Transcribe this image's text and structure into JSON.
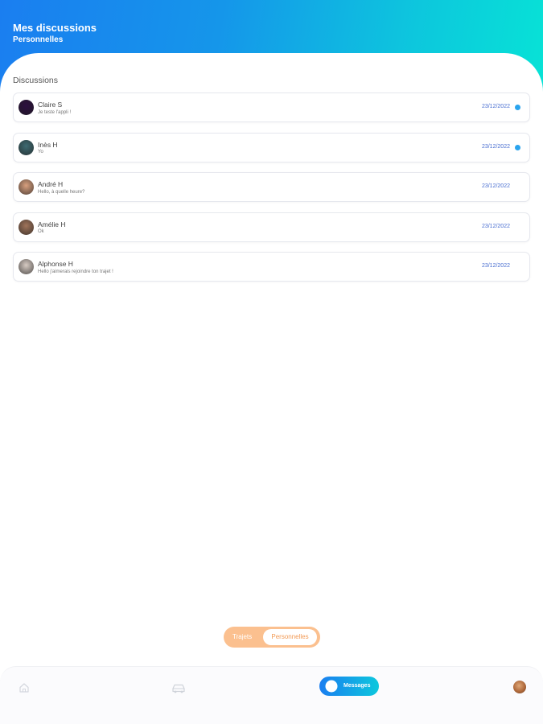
{
  "header": {
    "title": "Mes discussions",
    "subtitle": "Personnelles"
  },
  "section_label": "Discussions",
  "conversations": [
    {
      "name": "Claire S",
      "preview": "Je teste l'appli !",
      "date": "23/12/2022",
      "unread": true,
      "avatar_color": "#2c0f3f"
    },
    {
      "name": "Inès H",
      "preview": "Yo",
      "date": "23/12/2022",
      "unread": true,
      "avatar_color": "#3f6b72"
    },
    {
      "name": "André  H",
      "preview": "Hello, à quelle heure?",
      "date": "23/12/2022",
      "unread": false,
      "avatar_color": "#d9a07e"
    },
    {
      "name": "Amélie H",
      "preview": "Ok",
      "date": "23/12/2022",
      "unread": false,
      "avatar_color": "#a0745a"
    },
    {
      "name": "Alphonse  H",
      "preview": "Hello j'aimerais rejoindre ton trajet !",
      "date": "23/12/2022",
      "unread": false,
      "avatar_color": "#d7cbc3"
    }
  ],
  "toggle": {
    "left_label": "Trajets",
    "right_label": "Personnelles",
    "selected": "Personnelles"
  },
  "nav": {
    "home_icon": "home-icon",
    "car_icon": "car-icon",
    "messages_label": "Messages",
    "messages_icon": "chat-bubble-icon",
    "profile_icon": "profile-avatar"
  },
  "colors": {
    "header_start": "#1a7ef0",
    "header_end": "#07e3d6",
    "date": "#4a6fd1",
    "unread_dot": "#2aa4ee",
    "toggle_bg": "#fbc08f",
    "toggle_text_active": "#f29a55"
  }
}
